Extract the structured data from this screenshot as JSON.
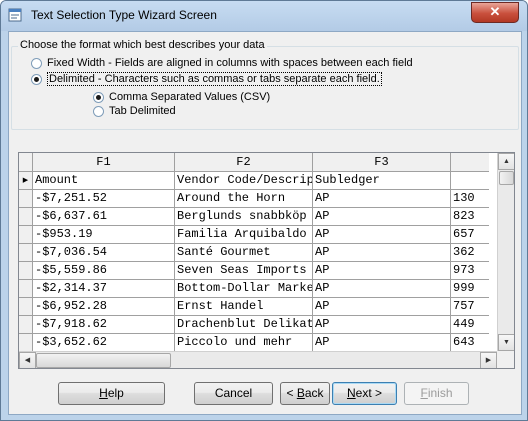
{
  "window": {
    "title": "Text Selection Type Wizard Screen",
    "close_glyph": "✕"
  },
  "format_group": {
    "legend": "Choose the format which best describes your data",
    "options": [
      {
        "label": "Fixed Width - Fields are aligned in columns with spaces between each field",
        "selected": false
      },
      {
        "label": "Delimited - Characters such as commas or tabs separate each field.",
        "selected": true
      }
    ],
    "delimiter_options": [
      {
        "label": "Comma Separated Values (CSV)",
        "selected": true
      },
      {
        "label": "Tab Delimited",
        "selected": false
      }
    ]
  },
  "grid": {
    "columns": [
      "F1",
      "F2",
      "F3",
      ""
    ],
    "current_row_marker": "▶",
    "rows": [
      [
        "Amount",
        "Vendor Code/Description",
        "Subledger",
        ""
      ],
      [
        "-$7,251.52",
        "Around the Horn",
        "AP",
        "130"
      ],
      [
        "-$6,637.61",
        "Berglunds snabbköp",
        "AP",
        "823"
      ],
      [
        "-$953.19",
        "Familia Arquibaldo",
        "AP",
        "657"
      ],
      [
        "-$7,036.54",
        "Santé Gourmet",
        "AP",
        "362"
      ],
      [
        "-$5,559.86",
        "Seven Seas Imports",
        "AP",
        "973"
      ],
      [
        "-$2,314.37",
        "Bottom-Dollar Markets",
        "AP",
        "999"
      ],
      [
        "-$6,952.28",
        "Ernst Handel",
        "AP",
        "757"
      ],
      [
        "-$7,918.62",
        "Drachenblut Delikatessen",
        "AP",
        "449"
      ],
      [
        "-$3,652.62",
        "Piccolo und mehr",
        "AP",
        "643"
      ]
    ]
  },
  "buttons": {
    "help": {
      "pre": "",
      "key": "H",
      "post": "elp"
    },
    "cancel": {
      "pre": "Cancel",
      "key": "",
      "post": ""
    },
    "back": {
      "pre": "< ",
      "key": "B",
      "post": "ack"
    },
    "next": {
      "pre": "",
      "key": "N",
      "post": "ext >"
    },
    "finish": {
      "pre": "",
      "key": "F",
      "post": "inish"
    }
  }
}
